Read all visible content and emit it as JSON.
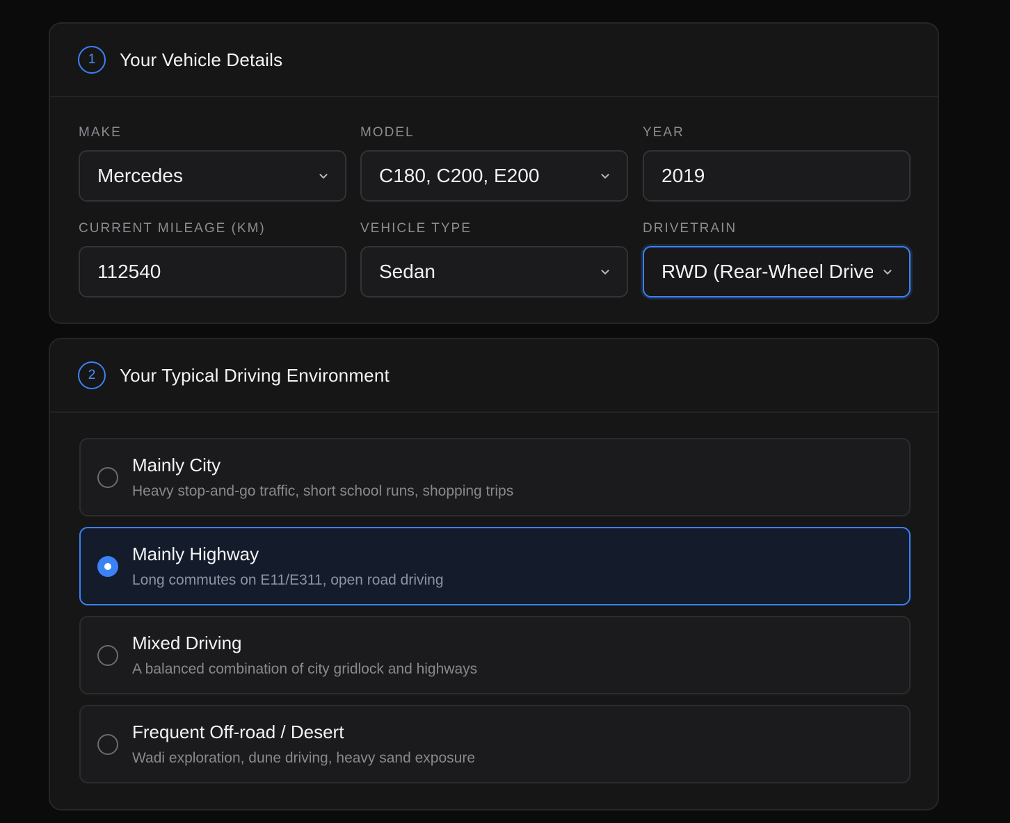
{
  "vehicle_section": {
    "step": "1",
    "title": "Your Vehicle Details",
    "fields": {
      "make": {
        "label": "MAKE",
        "value": "Mercedes"
      },
      "model": {
        "label": "MODEL",
        "value": "C180, C200, E200"
      },
      "year": {
        "label": "YEAR",
        "value": "2019"
      },
      "mileage": {
        "label": "CURRENT MILEAGE (KM)",
        "value": "112540"
      },
      "vehicle_type": {
        "label": "VEHICLE TYPE",
        "value": "Sedan"
      },
      "drivetrain": {
        "label": "DRIVETRAIN",
        "value": "RWD (Rear-Wheel Drive)"
      }
    }
  },
  "environment_section": {
    "step": "2",
    "title": "Your Typical Driving Environment",
    "options": [
      {
        "title": "Mainly City",
        "description": "Heavy stop-and-go traffic, short school runs, shopping trips",
        "selected": false
      },
      {
        "title": "Mainly Highway",
        "description": "Long commutes on E11/E311, open road driving",
        "selected": true
      },
      {
        "title": "Mixed Driving",
        "description": "A balanced combination of city gridlock and highways",
        "selected": false
      },
      {
        "title": "Frequent Off-road / Desert",
        "description": "Wadi exploration, dune driving, heavy sand exposure",
        "selected": false
      }
    ]
  },
  "colors": {
    "accent": "#3b82f6",
    "background": "#0b0b0c",
    "card": "#161617",
    "selected_option_bg": "#141c2c"
  },
  "icons": {
    "dropdown": "chevron-down-icon",
    "radio_on": "radio-selected-icon",
    "radio_off": "radio-unselected-icon"
  }
}
